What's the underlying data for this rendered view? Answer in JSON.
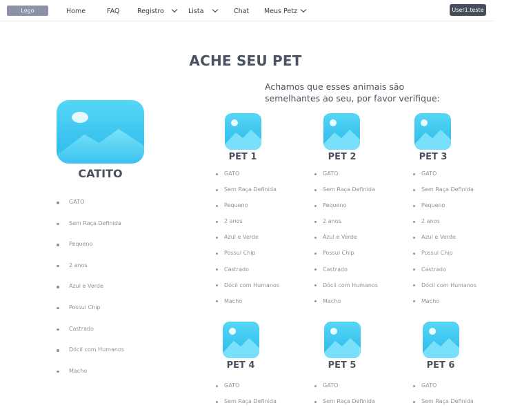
{
  "nav": {
    "logo": "Logo",
    "home": "Home",
    "faq": "FAQ",
    "registro": "Registro",
    "lista": "Lista",
    "chat": "Chat",
    "meus_petz": "Meus Petz",
    "user": "User1.teste"
  },
  "page": {
    "title": "ACHE SEU PET",
    "subtitle": "Achamos que esses animais são semelhantes ao seu, por favor verifique:"
  },
  "main_pet": {
    "name": "CATITO",
    "attributes": [
      "GATO",
      "Sem Raça Definida",
      "Pequeno",
      "2 anos",
      "Azul e Verde",
      "Possui Chip",
      "Castrado",
      "Dócil com Humanos",
      "Macho"
    ]
  },
  "pets": [
    {
      "name": "PET 1",
      "attributes": [
        "GATO",
        "Sem Raça Definida",
        "Pequeno",
        "2 anos",
        "Azul e Verde",
        "Possui Chip",
        "Castrado",
        "Dócil com Humanos",
        "Macho"
      ]
    },
    {
      "name": "PET 2",
      "attributes": [
        "GATO",
        "Sem Raça Definida",
        "Pequeno",
        "2 anos",
        "Azul e Verde",
        "Possui Chip",
        "Castrado",
        "Dócil com Humanos",
        "Macho"
      ]
    },
    {
      "name": "PET 3",
      "attributes": [
        "GATO",
        "Sem Raça Definida",
        "Pequeno",
        "2 anos",
        "Azul e Verde",
        "Possui Chip",
        "Castrado",
        "Dócil com Humanos",
        "Macho"
      ]
    },
    {
      "name": "PET 4",
      "attributes": [
        "GATO",
        "Sem Raça Definida"
      ]
    },
    {
      "name": "PET 5",
      "attributes": [
        "GATO",
        "Sem Raça Definida"
      ]
    },
    {
      "name": "PET 6",
      "attributes": [
        "GATO",
        "Sem Raça Definida"
      ]
    }
  ],
  "colors": {
    "accent": "#2bb8ec",
    "user_button": "#454f5b",
    "logo_bg": "#8a94a6"
  }
}
